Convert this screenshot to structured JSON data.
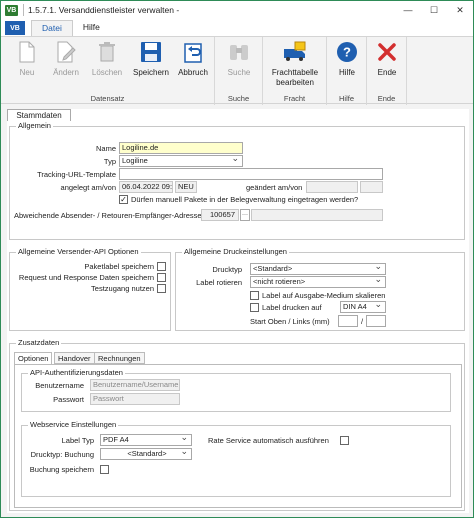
{
  "window": {
    "title": "1.5.7.1. Versanddienstleister verwalten -",
    "app_icon": "VB",
    "qa_label": "VB"
  },
  "ribbon_tabs": [
    {
      "label": "Datei"
    },
    {
      "label": "Hilfe"
    }
  ],
  "ribbon": {
    "buttons": [
      {
        "label": "Neu",
        "icon": "new-document-icon",
        "enabled": false
      },
      {
        "label": "Ändern",
        "icon": "edit-document-icon",
        "enabled": false
      },
      {
        "label": "Löschen",
        "icon": "trash-icon",
        "enabled": false
      },
      {
        "label": "Speichern",
        "icon": "save-icon",
        "enabled": true
      },
      {
        "label": "Abbruch",
        "icon": "undo-icon",
        "enabled": true
      },
      {
        "label": "Suche",
        "icon": "binoculars-icon",
        "enabled": false
      },
      {
        "label": "Frachttabelle bearbeiten",
        "icon": "truck-table-icon",
        "enabled": true
      },
      {
        "label": "Hilfe",
        "icon": "help-icon",
        "enabled": true
      },
      {
        "label": "Ende",
        "icon": "close-x-icon",
        "enabled": true
      }
    ],
    "groups": [
      "Datensatz",
      "Suche",
      "Fracht",
      "Hilfe",
      "Ende"
    ]
  },
  "main_tab": "Stammdaten",
  "allgemein": {
    "legend": "Allgemein",
    "name_label": "Name",
    "name_value": "Logiline.de",
    "typ_label": "Typ",
    "typ_value": "Logiline",
    "tracking_label": "Tracking-URL-Template",
    "tracking_value": "",
    "angelegt_label": "angelegt am/von",
    "angelegt_date": "06.04.2022 09:",
    "angelegt_user": "NEU",
    "geaendert_label": "geändert am/von",
    "geaendert_date": "",
    "geaendert_user": "",
    "manual_label": "Dürfen manuell Pakete in der Belegverwaltung eingetragen werden?",
    "manual_checked": true,
    "absender_label": "Abweichende Absender- / Retouren-Empfänger-Adresse",
    "absender_value": "100657",
    "absender_btn": "···"
  },
  "api_options": {
    "legend": "Allgemeine Versender-API Optionen",
    "items": [
      {
        "label": "Paketlabel speichern",
        "checked": false
      },
      {
        "label": "Request und Response Daten speichern",
        "checked": false
      },
      {
        "label": "Testzugang nutzen",
        "checked": false
      }
    ]
  },
  "druck": {
    "legend": "Allgemeine Druckeinstellungen",
    "drucktyp_label": "Drucktyp",
    "drucktyp_value": "<Standard>",
    "label_rotieren_label": "Label rotieren",
    "label_rotieren_value": "<nicht rotieren>",
    "skalieren_label": "Label auf Ausgabe-Medium skalieren",
    "skalieren_checked": false,
    "drucken_auf_label": "Label drucken auf",
    "drucken_auf_checked": false,
    "drucken_auf_value": "DIN A4",
    "start_label": "Start Oben / Links (mm)",
    "start_oben": "",
    "start_links": "",
    "start_sep": "/"
  },
  "zusatz": {
    "legend": "Zusatzdaten",
    "tabs": [
      {
        "label": "Optionen"
      },
      {
        "label": "Handover"
      },
      {
        "label": "Rechnungen"
      }
    ],
    "auth_legend": "API-Authentifizierungsdaten",
    "benutzer_label": "Benutzername",
    "benutzer_placeholder": "Benutzername/Username",
    "passwort_label": "Passwort",
    "passwort_placeholder": "Passwort",
    "ws_legend": "Webservice Einstellungen",
    "labeltyp_label": "Label Typ",
    "labeltyp_value": "PDF A4",
    "rate_label": "Rate Service automatisch ausführen",
    "rate_checked": false,
    "drucktyp_buchung_label": "Drucktyp: Buchung",
    "drucktyp_buchung_value": "<Standard>",
    "buchung_speichern_label": "Buchung speichern",
    "buchung_speichern_checked": false
  },
  "colors": {
    "accent": "#1f5fb0",
    "save": "#1f5fb0",
    "close": "#d32f2f",
    "app": "#2e7d32"
  }
}
